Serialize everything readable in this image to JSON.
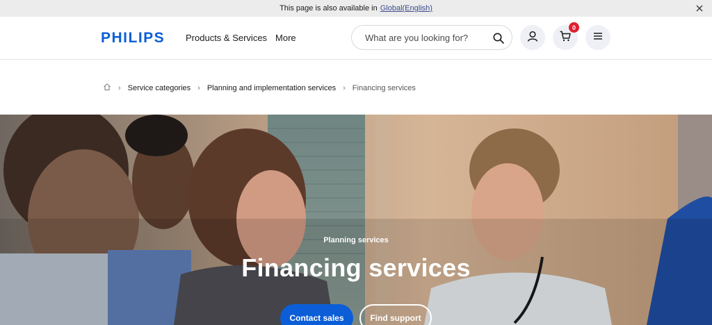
{
  "notice": {
    "text": "This page is also available in",
    "link_label": "Global(English)",
    "close_icon": "close-icon"
  },
  "header": {
    "logo": "PHILIPS",
    "nav": [
      "Products & Services",
      "More"
    ],
    "search": {
      "placeholder": "What are you looking for?",
      "icon": "search-icon"
    },
    "account_icon": "user-icon",
    "cart": {
      "icon": "cart-icon",
      "count": "0"
    },
    "menu_icon": "hamburger-menu-icon",
    "brand_color": "#0b5ed7",
    "badge_color": "#e01e2d"
  },
  "breadcrumb": {
    "home_icon": "home-icon",
    "items": [
      "Service categories",
      "Planning and implementation services"
    ],
    "current": "Financing services"
  },
  "hero": {
    "eyebrow": "Planning services",
    "title": "Financing services",
    "primary_button": "Contact sales",
    "secondary_button": "Find support"
  }
}
